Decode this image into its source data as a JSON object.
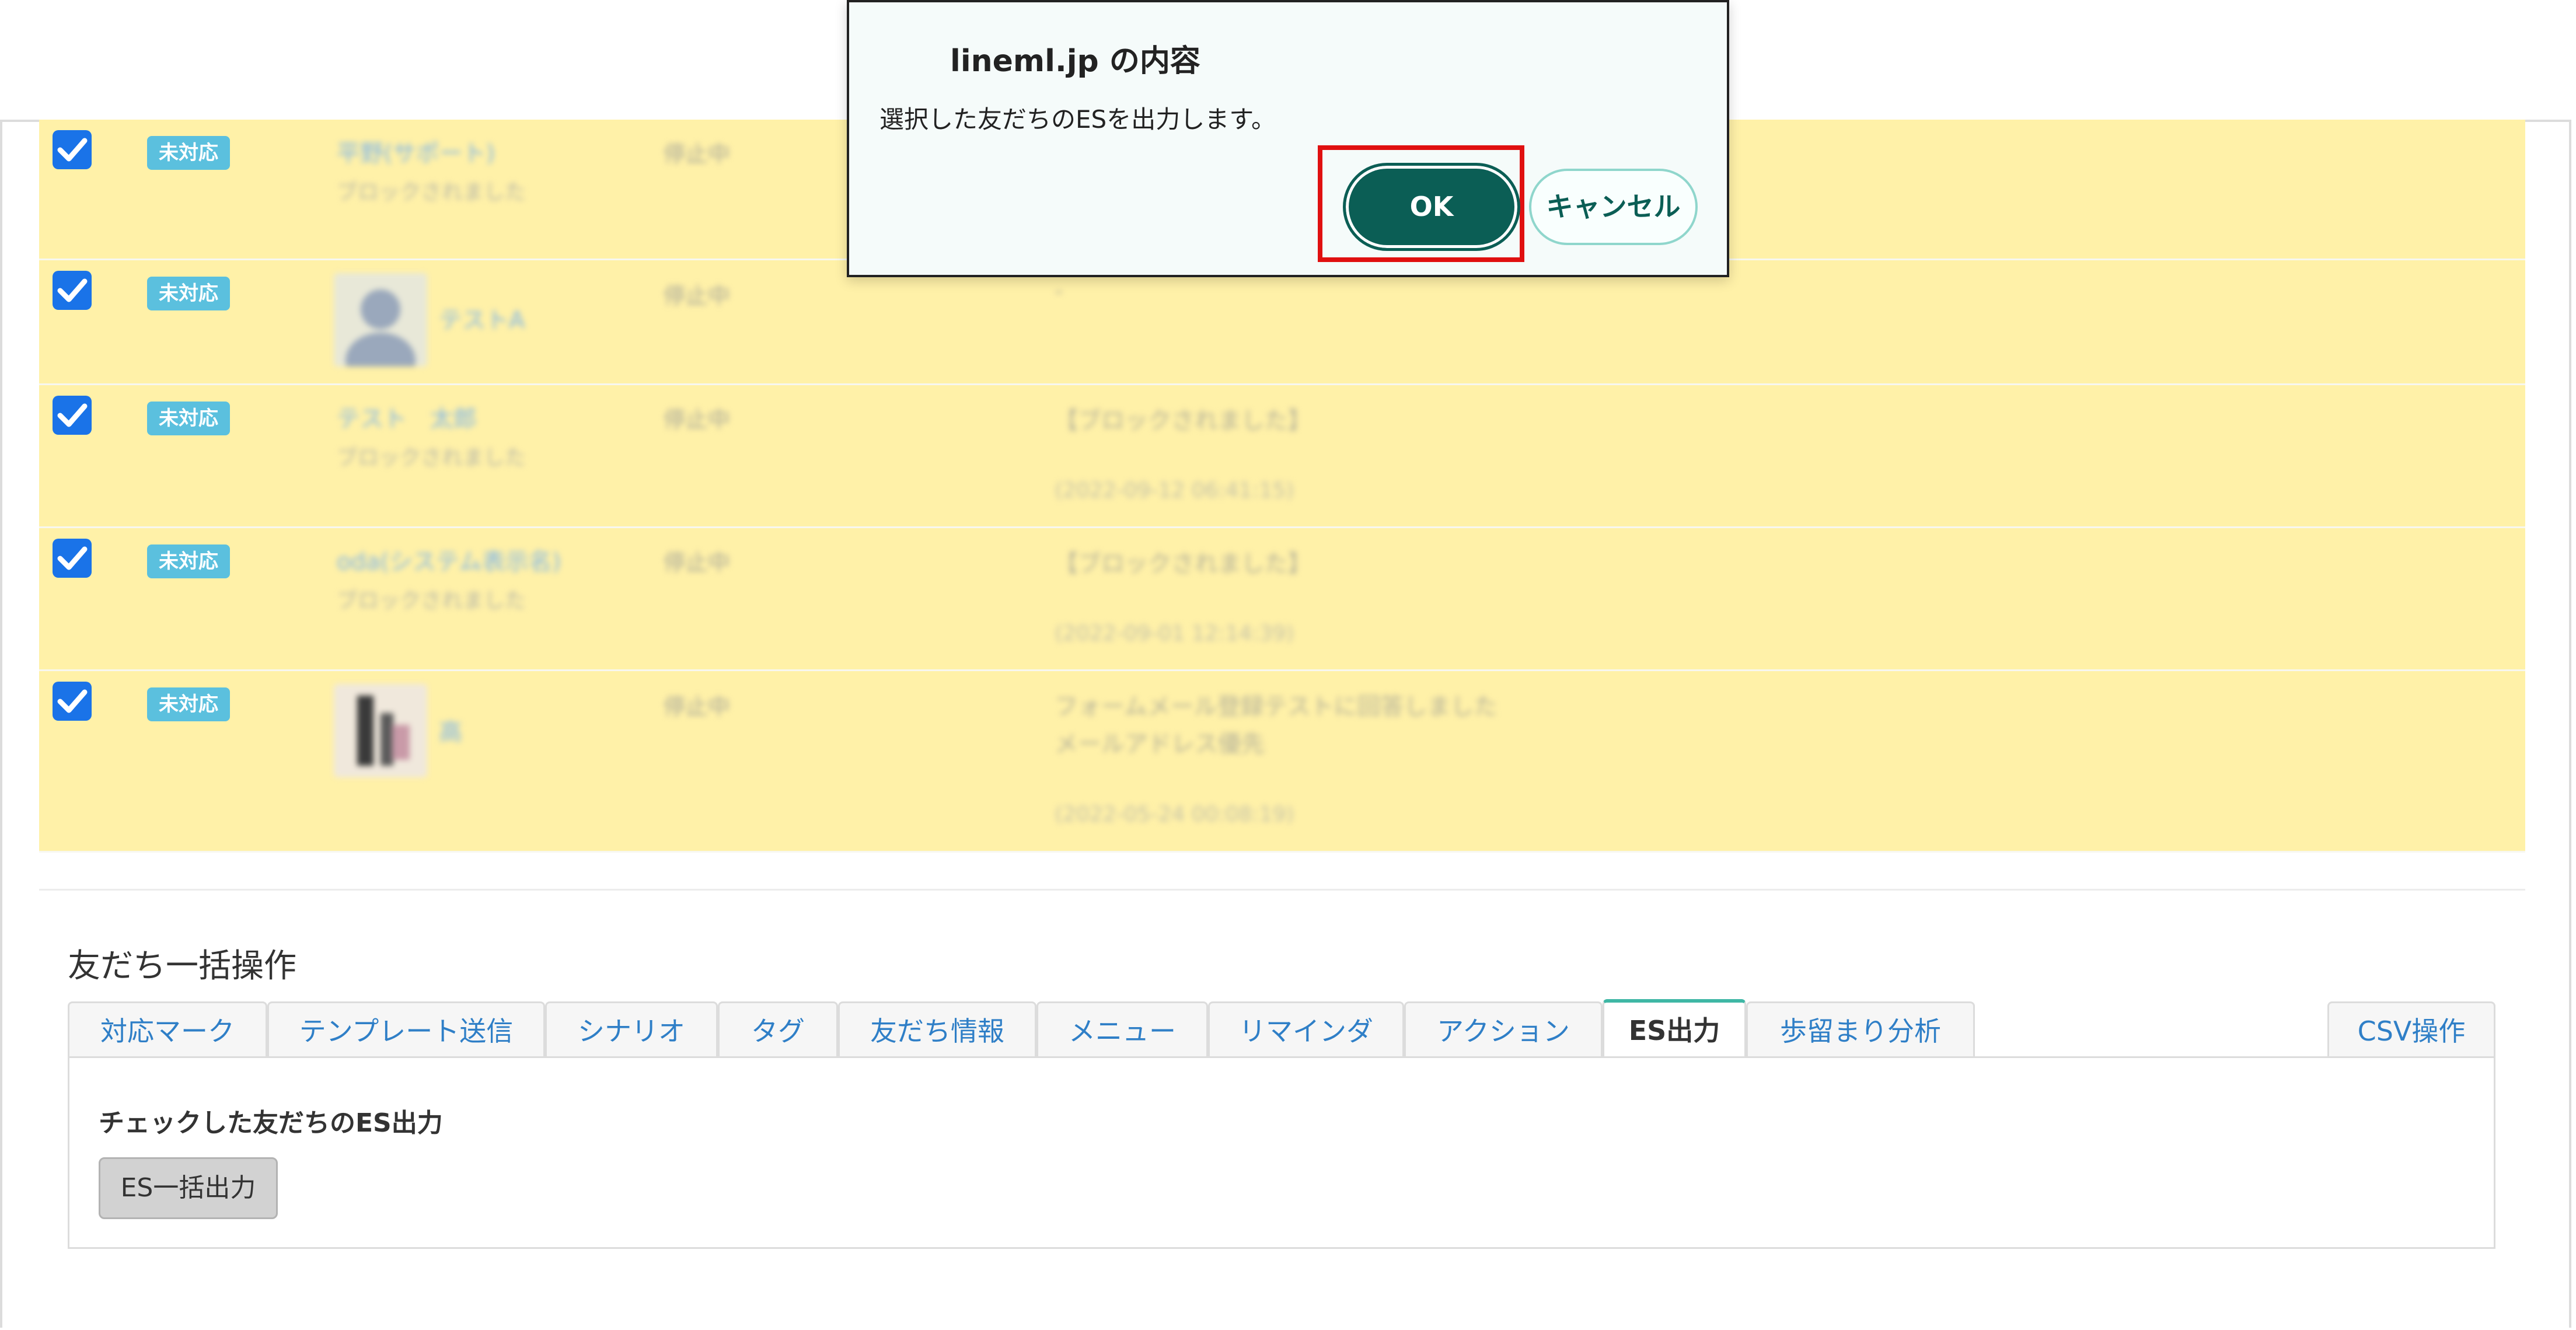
{
  "dialog": {
    "title": "lineml.jp の内容",
    "message": "選択した友だちのESを出力します。",
    "ok_label": "OK",
    "cancel_label": "キャンセル"
  },
  "rows": [
    {
      "checked": true,
      "status_badge": "未対応",
      "name": "平野(サポート)",
      "sub": "ブロックされました",
      "state": "停止中",
      "message": "",
      "date": ""
    },
    {
      "checked": true,
      "status_badge": "未対応",
      "name": "テストA",
      "sub": "",
      "state": "停止中",
      "message": "-",
      "date": ""
    },
    {
      "checked": true,
      "status_badge": "未対応",
      "name": "テスト　太郎",
      "sub": "ブロックされました",
      "state": "停止中",
      "message": "【ブロックされました】",
      "date": "(2022-09-12 06:41:15)"
    },
    {
      "checked": true,
      "status_badge": "未対応",
      "name": "oda(システム表示名)",
      "sub": "ブロックされました",
      "state": "停止中",
      "message": "【ブロックされました】",
      "date": "(2022-09-01 12:14:39)"
    },
    {
      "checked": true,
      "status_badge": "未対応",
      "name": "高",
      "sub": "",
      "state": "停止中",
      "message": "フォームメール登録テストに回答しました",
      "message2": "メールアドレス優先",
      "date": "(2022-05-24 00:08:19)"
    }
  ],
  "bulk": {
    "title": "友だち一括操作",
    "tabs": [
      "対応マーク",
      "テンプレート送信",
      "シナリオ",
      "タグ",
      "友だち情報",
      "メニュー",
      "リマインダ",
      "アクション",
      "ES出力",
      "歩留まり分析"
    ],
    "active_tab": "ES出力",
    "csv_tab": "CSV操作",
    "panel_label": "チェックした友だちのES出力",
    "es_button": "ES一括出力"
  },
  "colors": {
    "row_highlight": "#fff1a8",
    "badge": "#5bc0de",
    "checkbox": "#1a73e8",
    "ok_button": "#0b5e55",
    "highlight_box": "#e01010",
    "active_tab_border": "#3fb7a5"
  }
}
